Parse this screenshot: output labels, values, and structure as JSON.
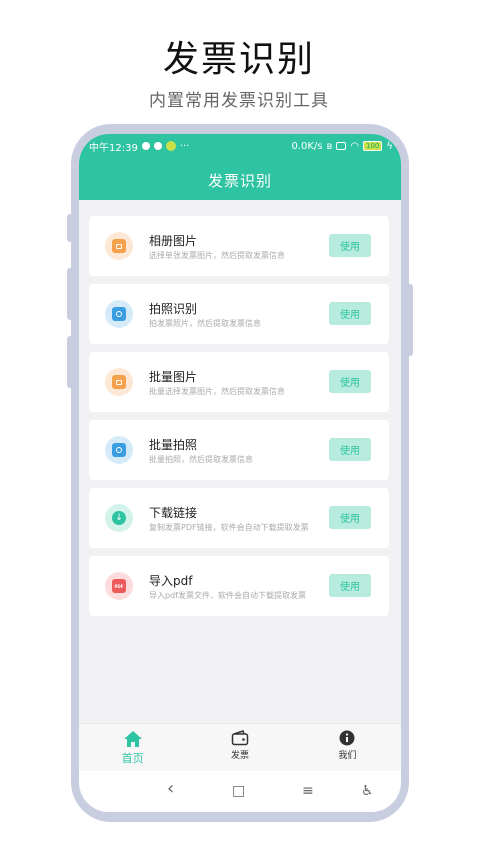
{
  "promo": {
    "title": "发票识别",
    "subtitle": "内置常用发票识别工具"
  },
  "status_bar": {
    "time": "中午12:39",
    "more": "···",
    "speed": "0.0K/s",
    "battery": "100"
  },
  "header": {
    "title": "发票识别"
  },
  "colors": {
    "accent": "#2ec4a2",
    "button_bg": "#b7ebdd",
    "orange": "#f5a04a",
    "blue": "#3a9ee0",
    "red": "#ee5a5a"
  },
  "features": [
    {
      "name": "相册图片",
      "desc": "选择单张发票图片，然后提取发票信息",
      "button": "使用",
      "icon": "photo-icon"
    },
    {
      "name": "拍照识别",
      "desc": "拍发票照片，然后提取发票信息",
      "button": "使用",
      "icon": "camera-icon"
    },
    {
      "name": "批量图片",
      "desc": "批量选择发票图片，然后提取发票信息",
      "button": "使用",
      "icon": "photo-icon"
    },
    {
      "name": "批量拍照",
      "desc": "批量拍照，然后提取发票信息",
      "button": "使用",
      "icon": "camera-icon"
    },
    {
      "name": "下载链接",
      "desc": "复制发票PDF链接，软件会自动下载提取发票",
      "button": "使用",
      "icon": "download-icon"
    },
    {
      "name": "导入pdf",
      "desc": "导入pdf发票文件，软件会自动下载提取发票",
      "button": "使用",
      "icon": "pdf-icon",
      "icon_text": "PDF"
    }
  ],
  "tabs": [
    {
      "label": "首页",
      "icon": "home-icon"
    },
    {
      "label": "发票",
      "icon": "wallet-icon"
    },
    {
      "label": "我们",
      "icon": "info-icon"
    }
  ],
  "nav": {
    "back": "‹",
    "home": "□",
    "menu": "≡",
    "accessibility": "♿"
  }
}
